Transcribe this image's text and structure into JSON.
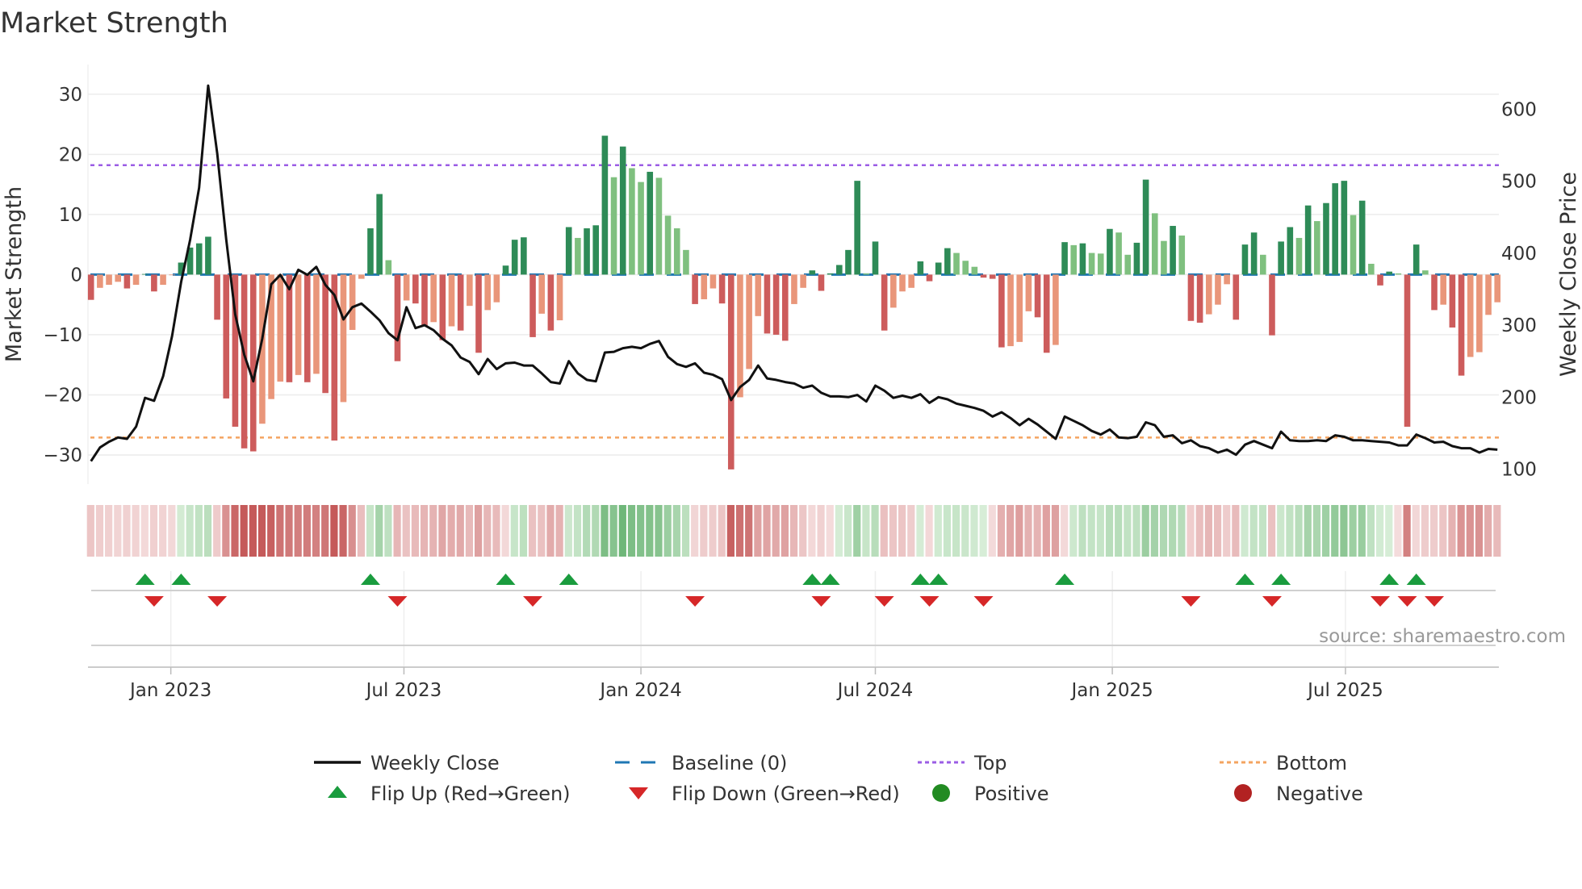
{
  "chart_data": {
    "type": "bar",
    "title": "Market Strength",
    "ylabel_left": "Market Strength",
    "ylabel_right": "Weekly Close Price",
    "source": "source: sharemaestro.com",
    "frequency": "weekly",
    "start_date": "2022-10-31",
    "ylim_left": [
      -32.5,
      32.5
    ],
    "ylim_right": [
      75,
      650
    ],
    "left_ticks": [
      30,
      20,
      10,
      0,
      -10,
      -20,
      -30
    ],
    "left_tick_labels": [
      "30",
      "20",
      "10",
      "0",
      "−10",
      "−20",
      "−30"
    ],
    "right_ticks": [
      600,
      500,
      400,
      300,
      200,
      100
    ],
    "right_tick_labels": [
      "600",
      "500",
      "400",
      "300",
      "200",
      "100"
    ],
    "x_ticks": [
      {
        "date": "2023-01-01",
        "label": "Jan 2023"
      },
      {
        "date": "2023-07-01",
        "label": "Jul 2023"
      },
      {
        "date": "2024-01-01",
        "label": "Jan 2024"
      },
      {
        "date": "2024-07-01",
        "label": "Jul 2024"
      },
      {
        "date": "2025-01-01",
        "label": "Jan 2025"
      },
      {
        "date": "2025-07-01",
        "label": "Jul 2025"
      }
    ],
    "top_level": 18.2,
    "bottom_level": -27.1,
    "baseline": 0,
    "strength": [
      -4.2,
      -2.2,
      -1.7,
      -1.2,
      -2.3,
      -1.7,
      0.1,
      -2.8,
      -1.7,
      -0.1,
      2.0,
      4.5,
      5.2,
      6.3,
      -7.5,
      -20.6,
      -25.3,
      -28.9,
      -29.4,
      -24.8,
      -20.7,
      -17.8,
      -17.9,
      -16.7,
      -17.9,
      -16.5,
      -19.7,
      -27.6,
      -21.2,
      -9.2,
      -0.7,
      7.7,
      13.4,
      2.4,
      -14.4,
      -4.3,
      -4.8,
      -8.5,
      -7.9,
      -10.9,
      -8.6,
      -9.3,
      -5.2,
      -13.0,
      -5.9,
      -4.6,
      1.5,
      5.8,
      6.2,
      -10.4,
      -6.5,
      -9.3,
      -7.6,
      7.9,
      6.1,
      7.7,
      8.2,
      23.1,
      16.2,
      21.3,
      17.7,
      15.4,
      17.1,
      16.1,
      9.8,
      7.7,
      4.1,
      -4.9,
      -4.1,
      -2.3,
      -4.8,
      -32.4,
      -20.4,
      -15.7,
      -6.9,
      -9.8,
      -10.0,
      -11.0,
      -4.9,
      -2.2,
      0.7,
      -2.7,
      0.2,
      1.6,
      4.1,
      15.6,
      0.2,
      5.5,
      -9.3,
      -5.5,
      -2.8,
      -2.2,
      2.2,
      -1.1,
      2.0,
      4.4,
      3.6,
      2.3,
      1.3,
      -0.5,
      -0.7,
      -12.1,
      -11.9,
      -11.2,
      -6.1,
      -7.1,
      -13.0,
      -11.7,
      5.4,
      4.9,
      5.2,
      3.6,
      3.5,
      7.6,
      7.0,
      3.3,
      5.3,
      15.8,
      10.2,
      5.6,
      8.1,
      6.5,
      -7.7,
      -8.0,
      -6.6,
      -5.0,
      -1.6,
      -7.5,
      5.0,
      7.0,
      3.3,
      -10.1,
      5.5,
      7.9,
      6.1,
      11.5,
      8.9,
      11.9,
      15.2,
      15.6,
      9.9,
      12.3,
      1.8,
      -1.8,
      0.5,
      0.2,
      -25.3,
      5.0,
      0.7,
      -5.9,
      -5.0,
      -8.8,
      -16.8,
      -13.7,
      -12.9,
      -6.7,
      -4.6
    ],
    "weekly_close": [
      111,
      130,
      138,
      144,
      142,
      159,
      199,
      195,
      229,
      285,
      360,
      419,
      491,
      633,
      539,
      419,
      315,
      259,
      222,
      281,
      357,
      370,
      350,
      377,
      370,
      381,
      356,
      342,
      308,
      325,
      330,
      319,
      307,
      289,
      279,
      325,
      296,
      300,
      293,
      281,
      272,
      255,
      249,
      232,
      253,
      239,
      247,
      248,
      244,
      244,
      233,
      221,
      219,
      250,
      233,
      224,
      222,
      262,
      263,
      268,
      270,
      268,
      274,
      278,
      256,
      246,
      242,
      247,
      234,
      231,
      225,
      196,
      214,
      224,
      244,
      226,
      224,
      221,
      219,
      213,
      216,
      206,
      201,
      201,
      200,
      203,
      194,
      216,
      209,
      199,
      202,
      199,
      204,
      192,
      200,
      197,
      191,
      188,
      185,
      181,
      173,
      179,
      171,
      161,
      170,
      162,
      152,
      142,
      173,
      167,
      161,
      153,
      148,
      155,
      144,
      143,
      145,
      165,
      161,
      145,
      147,
      136,
      140,
      132,
      129,
      123,
      127,
      120,
      134,
      139,
      134,
      129,
      152,
      140,
      139,
      139,
      140,
      139,
      147,
      145,
      140,
      140,
      139,
      138,
      137,
      133,
      133,
      148,
      143,
      137,
      138,
      132,
      129,
      129,
      123,
      128,
      127
    ],
    "legend": [
      {
        "label": "Weekly Close",
        "symbol": "line"
      },
      {
        "label": "Baseline (0)",
        "symbol": "dashed"
      },
      {
        "label": "Top",
        "symbol": "dotted-purple"
      },
      {
        "label": "Bottom",
        "symbol": "dotted-orange"
      },
      {
        "label": "Flip Up (Red→Green)",
        "symbol": "triangle-up"
      },
      {
        "label": "Flip Down (Green→Red)",
        "symbol": "triangle-down"
      },
      {
        "label": "Positive",
        "symbol": "circle-green"
      },
      {
        "label": "Negative",
        "symbol": "circle-red"
      }
    ],
    "legend_position": "bottom",
    "colors": {
      "pos_strong": "#2e8b57",
      "pos_weak": "#7fc07f",
      "neg_strong": "#cd5c5c",
      "neg_weak": "#e9967a",
      "line": "#111111",
      "baseline": "#1f77b4",
      "top": "#9b5de5",
      "bottom": "#f4a460",
      "flip_up": "#1a9c3e",
      "flip_down": "#d62728",
      "positive": "#228b22",
      "negative": "#b22222"
    }
  }
}
